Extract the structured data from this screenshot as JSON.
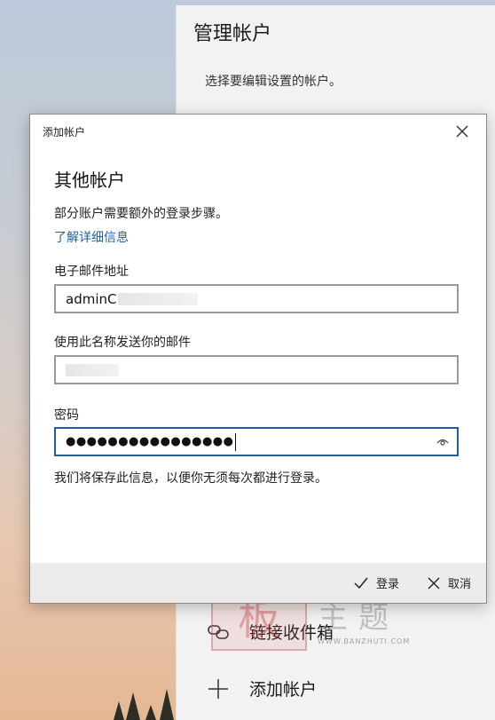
{
  "settings_panel": {
    "title": "管理帐户",
    "subtitle": "选择要编辑设置的帐户。",
    "items": [
      {
        "label": "链接收件箱",
        "icon": "link-icon"
      },
      {
        "label": "添加帐户",
        "icon": "plus-icon"
      }
    ]
  },
  "watermark": {
    "stamp": "板",
    "text": "主题",
    "url": "WWW.BANZHUTI.COM"
  },
  "dialog": {
    "window_title": "添加帐户",
    "heading": "其他帐户",
    "description": "部分账户需要额外的登录步骤。",
    "learn_more_link": "了解详细信息",
    "email": {
      "label": "电子邮件地址",
      "value": "adminⅭ"
    },
    "display_name": {
      "label": "使用此名称发送你的邮件",
      "value": ""
    },
    "password": {
      "label": "密码",
      "value_masked": "●●●●●●●●●●●●●●●●"
    },
    "save_note": "我们将保存此信息，以便你无须每次都进行登录。",
    "footer": {
      "sign_in": "登录",
      "cancel": "取消"
    }
  },
  "colors": {
    "link": "#1f63a6",
    "focus_border": "#1e5ea8",
    "footer_bg": "#ececec"
  }
}
